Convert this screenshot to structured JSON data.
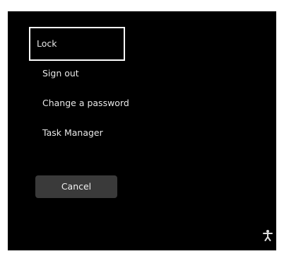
{
  "menu": {
    "items": [
      {
        "label": "Lock",
        "focused": true
      },
      {
        "label": "Sign out"
      },
      {
        "label": "Change a password"
      },
      {
        "label": "Task Manager"
      }
    ]
  },
  "cancel_label": "Cancel",
  "icons": {
    "accessibility": "accessibility-icon"
  },
  "colors": {
    "background": "#000000",
    "text": "#e8e8e8",
    "button": "#3a3a3a",
    "focus_outline": "#ffffff"
  }
}
